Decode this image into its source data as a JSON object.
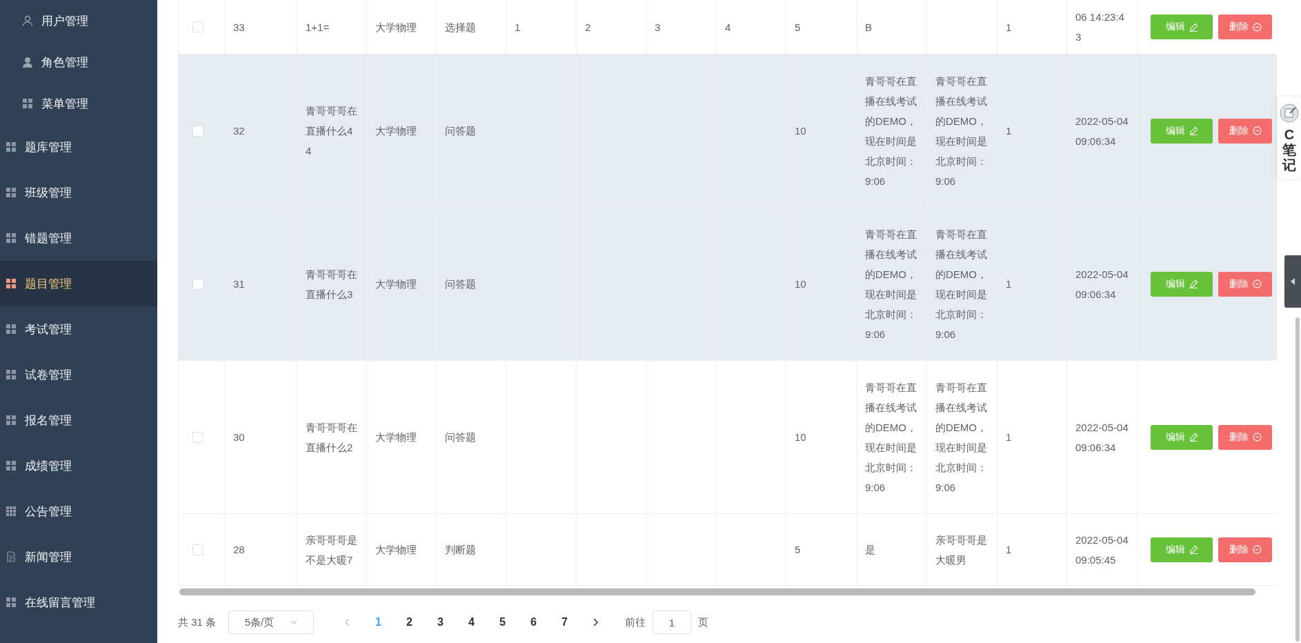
{
  "sidebar": {
    "submenu_items": [
      {
        "label": "用户管理",
        "selected": false
      },
      {
        "label": "角色管理",
        "selected": false
      },
      {
        "label": "菜单管理",
        "selected": false
      }
    ],
    "items": [
      {
        "label": "题库管理",
        "selected": false
      },
      {
        "label": "班级管理",
        "selected": false
      },
      {
        "label": "错题管理",
        "selected": false
      },
      {
        "label": "题目管理",
        "selected": true
      },
      {
        "label": "考试管理",
        "selected": false
      },
      {
        "label": "试卷管理",
        "selected": false
      },
      {
        "label": "报名管理",
        "selected": false
      },
      {
        "label": "成绩管理",
        "selected": false
      },
      {
        "label": "公告管理",
        "selected": false
      },
      {
        "label": "新闻管理",
        "selected": false
      },
      {
        "label": "在线留言管理",
        "selected": false
      }
    ]
  },
  "table": {
    "rows": [
      {
        "checked": false,
        "highlighted": false,
        "column_1": "33",
        "column_2": "1+1=",
        "column_3": "大学物理",
        "column_4": "选择题",
        "column_5": "1",
        "column_6": "2",
        "column_7": "3",
        "column_8": "4",
        "column_9": "5",
        "column_10": "B",
        "column_12": "1",
        "column_13": "06 14:23:43",
        "actions": [
          "编辑",
          "删除"
        ]
      },
      {
        "checked": false,
        "highlighted": true,
        "column_1": "32",
        "column_2": "青哥哥哥在直播什么44",
        "column_3": "大学物理",
        "column_4": "问答题",
        "column_9": "10",
        "column_10": "青哥哥在直播在线考试的DEMO，现在时间是北京时间：9:06",
        "column_11": "青哥哥在直播在线考试的DEMO，现在时间是北京时间：9:06",
        "column_12": "1",
        "column_13": "2022-05-04 09:06:34",
        "actions": [
          "编辑",
          "删除"
        ]
      },
      {
        "checked": false,
        "highlighted": true,
        "column_1": "31",
        "column_2": "青哥哥哥在直播什么3",
        "column_3": "大学物理",
        "column_4": "问答题",
        "column_9": "10",
        "column_10": "青哥哥在直播在线考试的DEMO，现在时间是北京时间：9:06",
        "column_11": "青哥哥在直播在线考试的DEMO，现在时间是北京时间：9:06",
        "column_12": "1",
        "column_13": "2022-05-04 09:06:34",
        "actions": [
          "编辑",
          "删除"
        ]
      },
      {
        "checked": false,
        "highlighted": false,
        "column_1": "30",
        "column_2": "青哥哥哥在直播什么2",
        "column_3": "大学物理",
        "column_4": "问答题",
        "column_9": "10",
        "column_10": "青哥哥在直播在线考试的DEMO，现在时间是北京时间：9:06",
        "column_11": "青哥哥在直播在线考试的DEMO，现在时间是北京时间：9:06",
        "column_12": "1",
        "column_13": "2022-05-04 09:06:34",
        "actions": [
          "编辑",
          "删除"
        ]
      },
      {
        "checked": false,
        "highlighted": false,
        "column_1": "28",
        "column_2": "亲哥哥哥是不是大暖7",
        "column_3": "大学物理",
        "column_4": "判断题",
        "column_9": "5",
        "column_10": "是",
        "column_11": "亲哥哥哥是大暖男",
        "column_12": "1",
        "column_13": "2022-05-04 09:05:45",
        "actions": [
          "编辑",
          "删除"
        ]
      }
    ]
  },
  "pagination": {
    "total": "共 31 条",
    "page_size": "5条/页",
    "pages": [
      {
        "label": "1",
        "selected": true
      },
      {
        "label": "2",
        "selected": false
      },
      {
        "label": "3",
        "selected": false
      },
      {
        "label": "4",
        "selected": false
      },
      {
        "label": "5",
        "selected": false
      },
      {
        "label": "6",
        "selected": false
      },
      {
        "label": "7",
        "selected": false
      }
    ],
    "goto_label": "前往",
    "goto_value": "1",
    "goto_unit": "页"
  },
  "notes_widget": {
    "label": "C笔记"
  }
}
